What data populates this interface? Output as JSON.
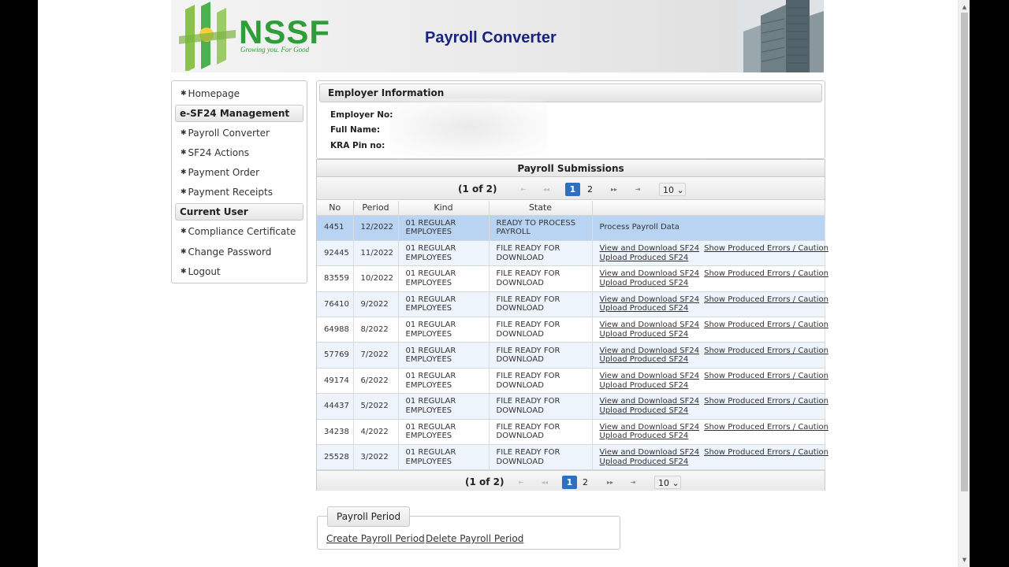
{
  "header": {
    "logo_text": "NSSF",
    "tagline": "Growing you. For Good",
    "app_title": "Payroll Converter"
  },
  "sidebar": {
    "items": [
      {
        "type": "item",
        "label": "Homepage"
      },
      {
        "type": "header",
        "label": "e-SF24 Management"
      },
      {
        "type": "item",
        "label": "Payroll Converter"
      },
      {
        "type": "item",
        "label": "SF24 Actions"
      },
      {
        "type": "item",
        "label": "Payment Order"
      },
      {
        "type": "item",
        "label": "Payment Receipts"
      },
      {
        "type": "header",
        "label": "Current User"
      },
      {
        "type": "item",
        "label": "Compliance Certificate"
      },
      {
        "type": "item",
        "label": "Change Password"
      },
      {
        "type": "item",
        "label": "Logout"
      }
    ]
  },
  "employer": {
    "title": "Employer Information",
    "fields": [
      {
        "label": "Employer No:",
        "value": ""
      },
      {
        "label": "Full Name:",
        "value": ""
      },
      {
        "label": "KRA Pin no:",
        "value": ""
      }
    ]
  },
  "submissions": {
    "title": "Payroll Submissions",
    "page_report": "(1 of 2)",
    "pages": [
      "1",
      "2"
    ],
    "current_page": "1",
    "rows_per_page": "10",
    "columns": [
      "No",
      "Period",
      "Kind",
      "State",
      ""
    ],
    "rows": [
      {
        "no": "4451",
        "period": "12/2022",
        "kind": "01 REGULAR EMPLOYEES",
        "state": "READY TO PROCESS PAYROLL",
        "actions": [
          "Process Payroll Data"
        ],
        "selected": true
      },
      {
        "no": "92445",
        "period": "11/2022",
        "kind": "01 REGULAR EMPLOYEES",
        "state": "FILE READY FOR DOWNLOAD",
        "actions": [
          "View and Download SF24",
          "Show Produced Errors / Caution",
          "Upload Produced SF24"
        ]
      },
      {
        "no": "83559",
        "period": "10/2022",
        "kind": "01 REGULAR EMPLOYEES",
        "state": "FILE READY FOR DOWNLOAD",
        "actions": [
          "View and Download SF24",
          "Show Produced Errors / Caution",
          "Upload Produced SF24"
        ]
      },
      {
        "no": "76410",
        "period": "9/2022",
        "kind": "01 REGULAR EMPLOYEES",
        "state": "FILE READY FOR DOWNLOAD",
        "actions": [
          "View and Download SF24",
          "Show Produced Errors / Caution",
          "Upload Produced SF24"
        ]
      },
      {
        "no": "64988",
        "period": "8/2022",
        "kind": "01 REGULAR EMPLOYEES",
        "state": "FILE READY FOR DOWNLOAD",
        "actions": [
          "View and Download SF24",
          "Show Produced Errors / Caution",
          "Upload Produced SF24"
        ]
      },
      {
        "no": "57769",
        "period": "7/2022",
        "kind": "01 REGULAR EMPLOYEES",
        "state": "FILE READY FOR DOWNLOAD",
        "actions": [
          "View and Download SF24",
          "Show Produced Errors / Caution",
          "Upload Produced SF24"
        ]
      },
      {
        "no": "49174",
        "period": "6/2022",
        "kind": "01 REGULAR EMPLOYEES",
        "state": "FILE READY FOR DOWNLOAD",
        "actions": [
          "View and Download SF24",
          "Show Produced Errors / Caution",
          "Upload Produced SF24"
        ]
      },
      {
        "no": "44437",
        "period": "5/2022",
        "kind": "01 REGULAR EMPLOYEES",
        "state": "FILE READY FOR DOWNLOAD",
        "actions": [
          "View and Download SF24",
          "Show Produced Errors / Caution",
          "Upload Produced SF24"
        ]
      },
      {
        "no": "34238",
        "period": "4/2022",
        "kind": "01 REGULAR EMPLOYEES",
        "state": "FILE READY FOR DOWNLOAD",
        "actions": [
          "View and Download SF24",
          "Show Produced Errors / Caution",
          "Upload Produced SF24"
        ]
      },
      {
        "no": "25528",
        "period": "3/2022",
        "kind": "01 REGULAR EMPLOYEES",
        "state": "FILE READY FOR DOWNLOAD",
        "actions": [
          "View and Download SF24",
          "Show Produced Errors / Caution",
          "Upload Produced SF24"
        ]
      }
    ]
  },
  "payroll_period": {
    "legend": "Payroll Period",
    "create_label": "Create Payroll Period",
    "delete_label": "Delete Payroll Period"
  },
  "icons": {
    "menu_bullet": "gear-icon",
    "pager_first": "first-page-icon",
    "pager_prev": "prev-page-icon",
    "pager_next": "next-page-icon",
    "pager_last": "last-page-icon"
  },
  "colors": {
    "brand_green": "#2e9d3a",
    "title_navy": "#1a237e",
    "selected_row": "#b9d4f3",
    "active_page": "#2f6fbf"
  }
}
